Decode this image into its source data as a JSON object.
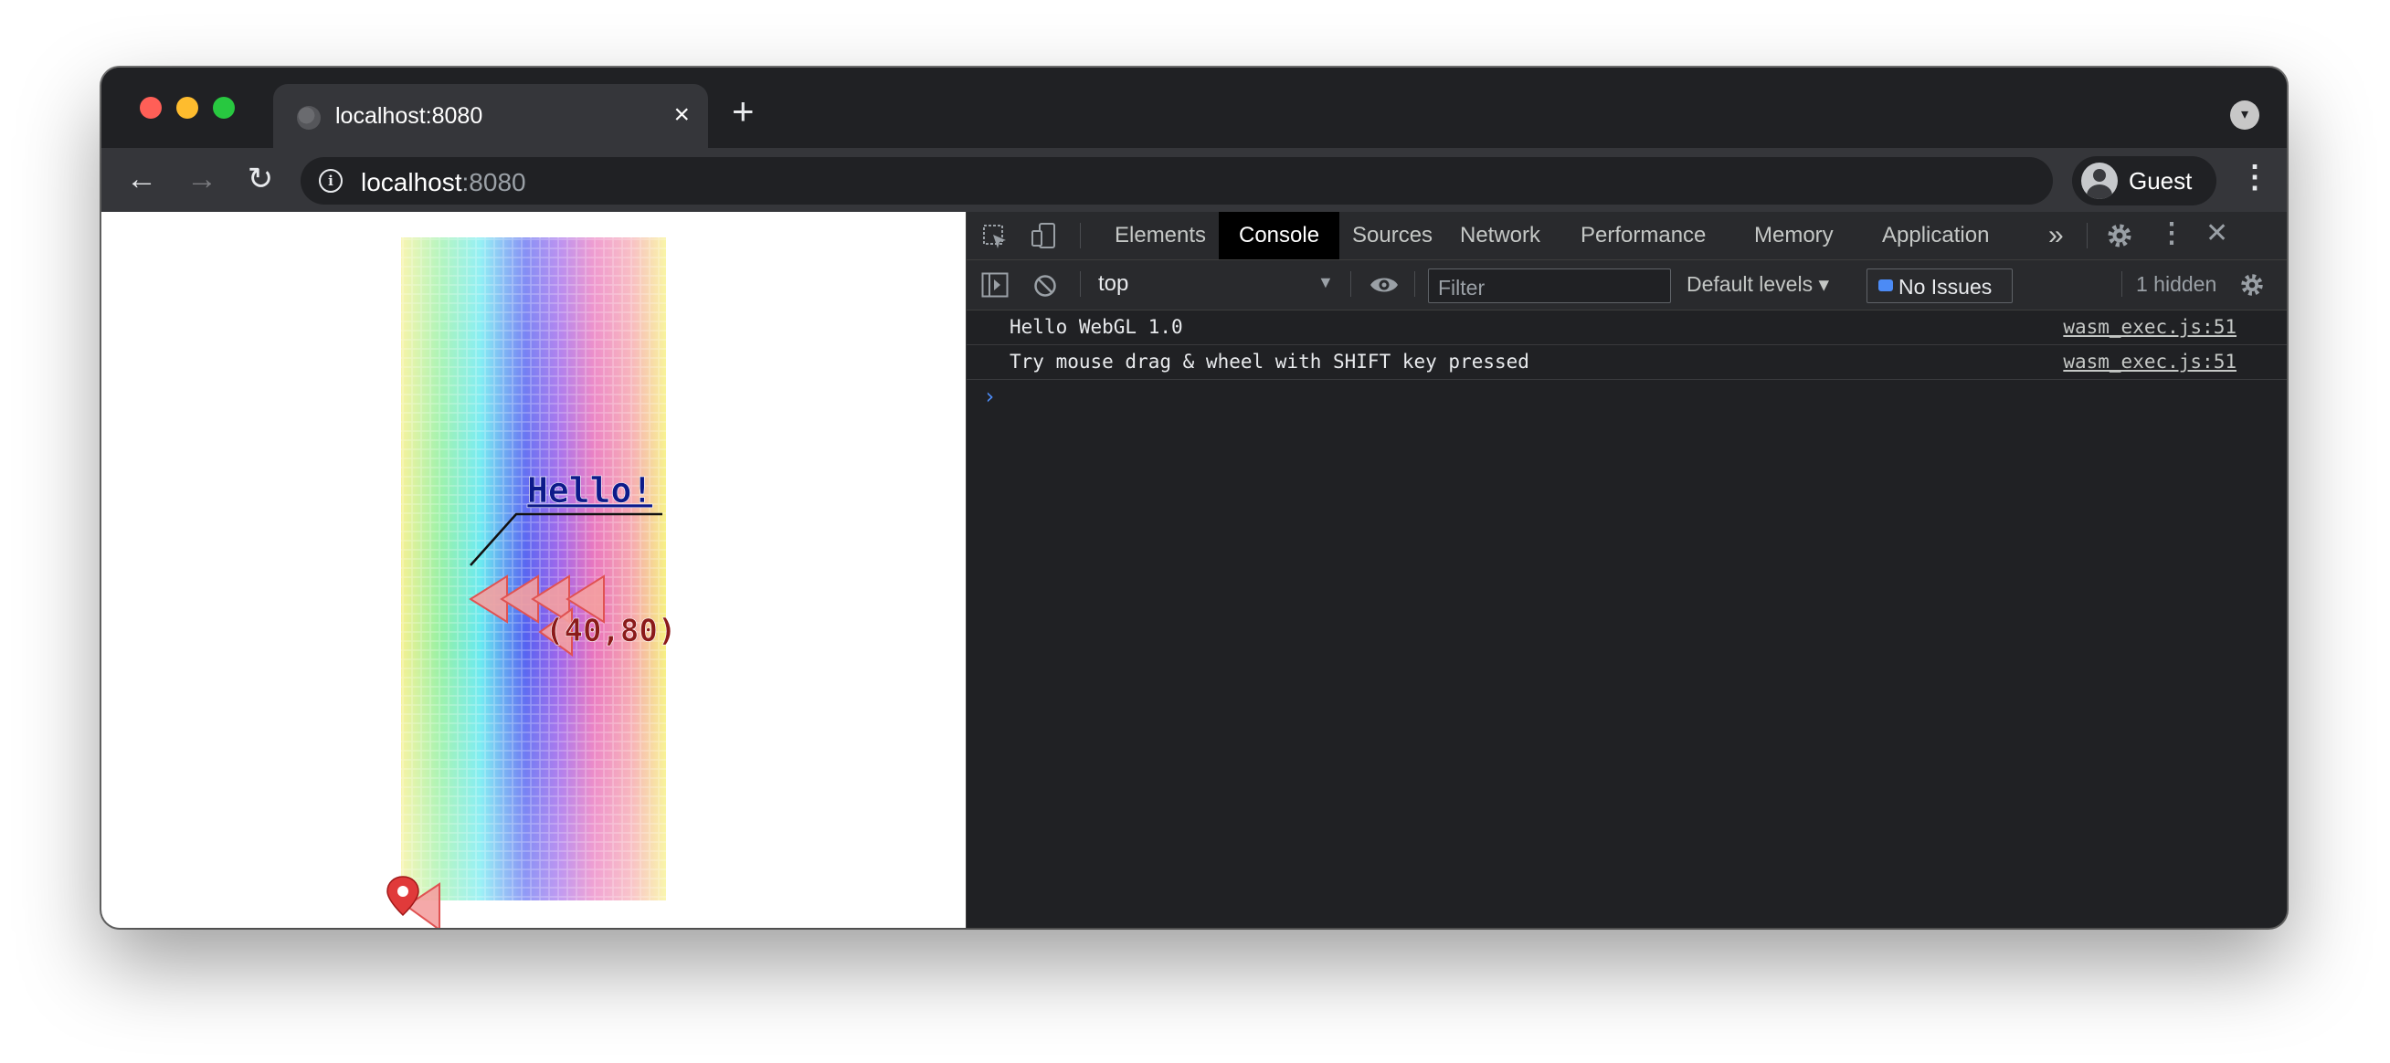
{
  "tab": {
    "title": "localhost:8080",
    "close": "×",
    "new_tab": "+"
  },
  "toolbar": {
    "back": "←",
    "forward": "→",
    "reload": "↻",
    "url_host": "localhost",
    "url_port": ":8080",
    "profile_label": "Guest",
    "menu": "⋮"
  },
  "page": {
    "canvas": {
      "greeting": "Hello!",
      "coordinate": "(40,80)"
    }
  },
  "devtools": {
    "tabs": [
      "Elements",
      "Console",
      "Sources",
      "Network",
      "Performance",
      "Memory",
      "Application"
    ],
    "active_tab": "Console",
    "more_tabs": "»",
    "context": "top",
    "filter_placeholder": "Filter",
    "levels": "Default levels ▾",
    "issues": "No Issues",
    "hidden": "1 hidden",
    "messages": [
      {
        "text": "Hello WebGL 1.0",
        "source": "wasm_exec.js:51"
      },
      {
        "text": "Try mouse drag & wheel with SHIFT key pressed",
        "source": "wasm_exec.js:51"
      }
    ],
    "prompt": "›"
  },
  "colors": {
    "chrome_dark": "#202124",
    "toolbar": "#35363a",
    "accent_blue": "#4c8bf5",
    "triangle_fill": "#f4a0a0",
    "triangle_stroke": "#e05252",
    "text_dark_red": "#8b1a1a",
    "text_navy": "#0d1a8a"
  }
}
